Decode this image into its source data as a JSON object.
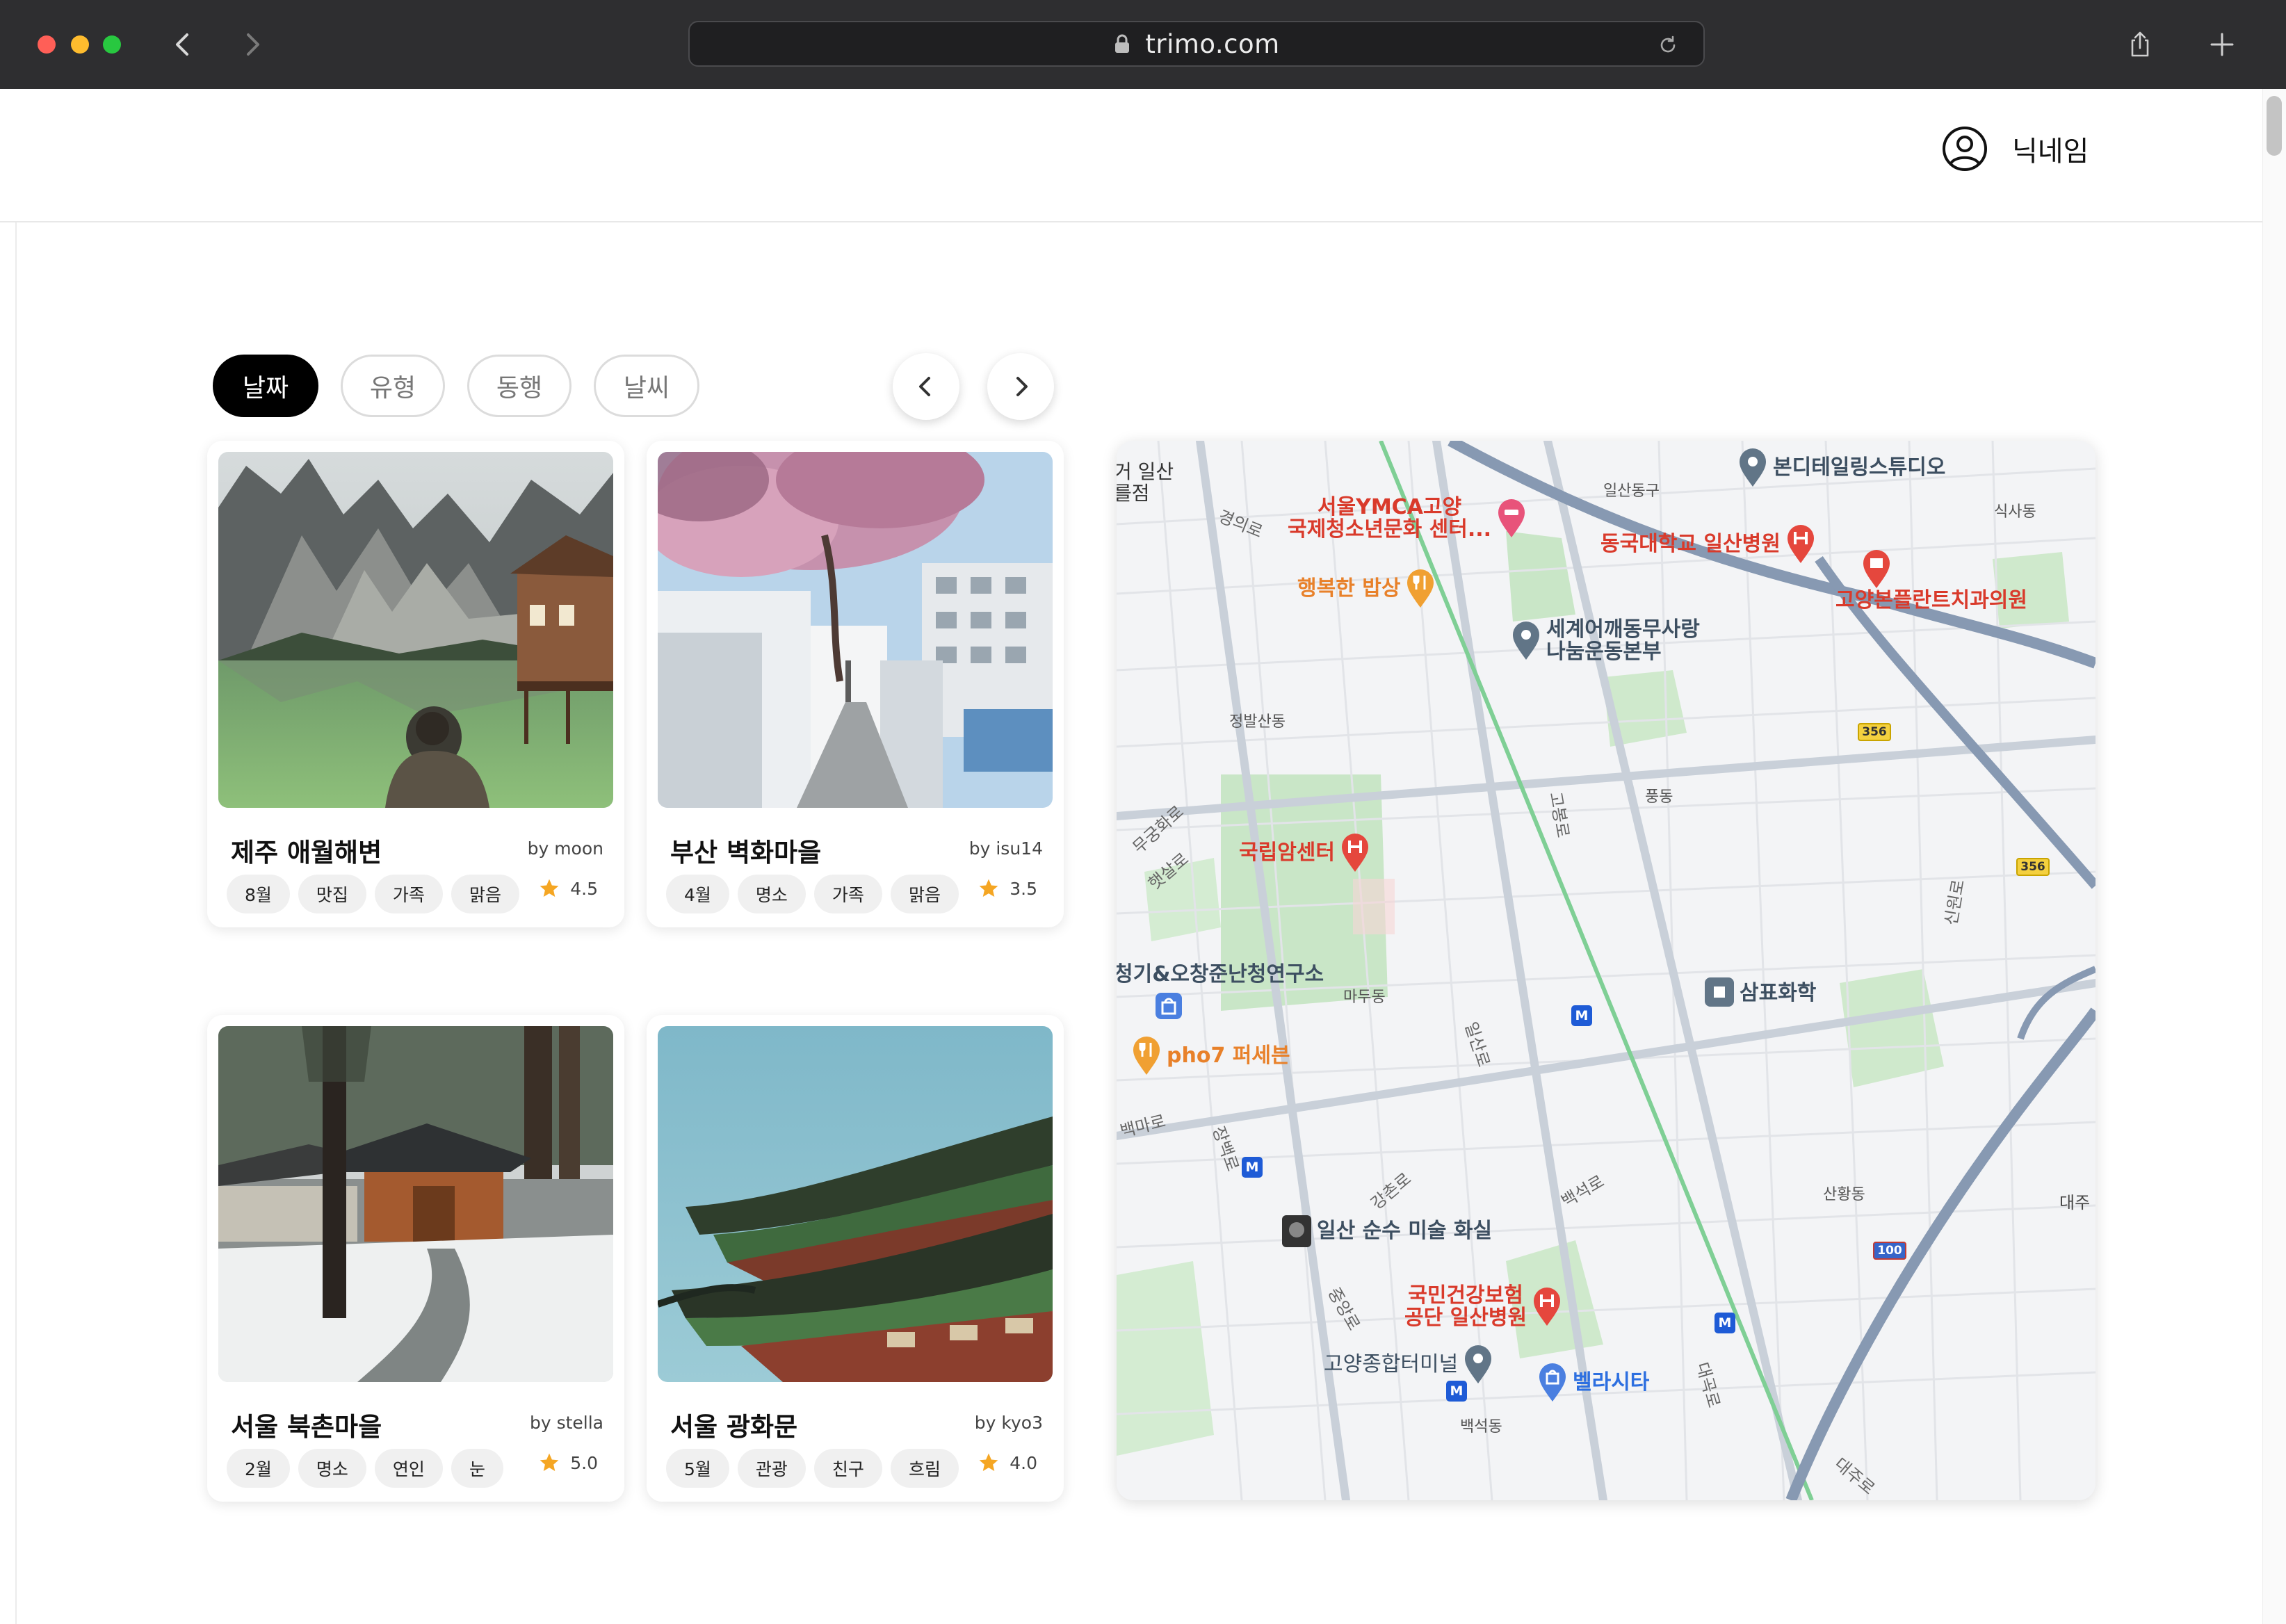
{
  "browser": {
    "url": "trimo.com"
  },
  "header": {
    "nickname": "닉네임"
  },
  "filters": [
    {
      "label": "날짜",
      "active": true
    },
    {
      "label": "유형",
      "active": false
    },
    {
      "label": "동행",
      "active": false
    },
    {
      "label": "날씨",
      "active": false
    }
  ],
  "cards": [
    {
      "title": "제주 애월해변",
      "author": "by moon",
      "tags": [
        "8월",
        "맛집",
        "가족",
        "맑음"
      ],
      "rating": "4.5"
    },
    {
      "title": "부산 벽화마을",
      "author": "by isu14",
      "tags": [
        "4월",
        "명소",
        "가족",
        "맑음"
      ],
      "rating": "3.5"
    },
    {
      "title": "서울 북촌마을",
      "author": "by stella",
      "tags": [
        "2월",
        "명소",
        "연인",
        "눈"
      ],
      "rating": "5.0"
    },
    {
      "title": "서울 광화문",
      "author": "by kyo3",
      "tags": [
        "5월",
        "관광",
        "친구",
        "흐림"
      ],
      "rating": "4.0"
    }
  ],
  "map": {
    "places": [
      {
        "name": "본디테일링스튜디오",
        "kind": "grey"
      },
      {
        "name": "서울YMCA고양\n국제청소년문화 센터...",
        "kind": "red"
      },
      {
        "name": "동국대학교 일산병원",
        "kind": "red"
      },
      {
        "name": "고양본플란트치과의원",
        "kind": "red"
      },
      {
        "name": "행복한 밥상",
        "kind": "orange"
      },
      {
        "name": "세계어깨동무사랑\n나눔운동본부",
        "kind": "grey"
      },
      {
        "name": "국립암센터",
        "kind": "red"
      },
      {
        "name": "청기&오창준난청연구소",
        "kind": "grey"
      },
      {
        "name": "pho7 퍼세븐",
        "kind": "orange"
      },
      {
        "name": "삼표화학",
        "kind": "grey"
      },
      {
        "name": "일산 순수 미술 화실",
        "kind": "grey"
      },
      {
        "name": "국민건강보험\n공단 일산병원",
        "kind": "red"
      },
      {
        "name": "고양종합터미널",
        "kind": "grey"
      },
      {
        "name": "벨라시타",
        "kind": "blue"
      }
    ],
    "districts": [
      "일산동구",
      "식사동",
      "정발산동",
      "풍동",
      "마두동",
      "산황동",
      "백석동"
    ],
    "roads": [
      "경의로",
      "일산로",
      "중앙로",
      "강촌로",
      "백석로",
      "고봉로",
      "무궁화로",
      "햇살로",
      "장백로",
      "백마로",
      "신원로",
      "대곡로",
      "대주로"
    ],
    "route_badges": [
      "356",
      "356",
      "100"
    ],
    "edge_labels": [
      "거 일산\n를점",
      "대주"
    ]
  }
}
